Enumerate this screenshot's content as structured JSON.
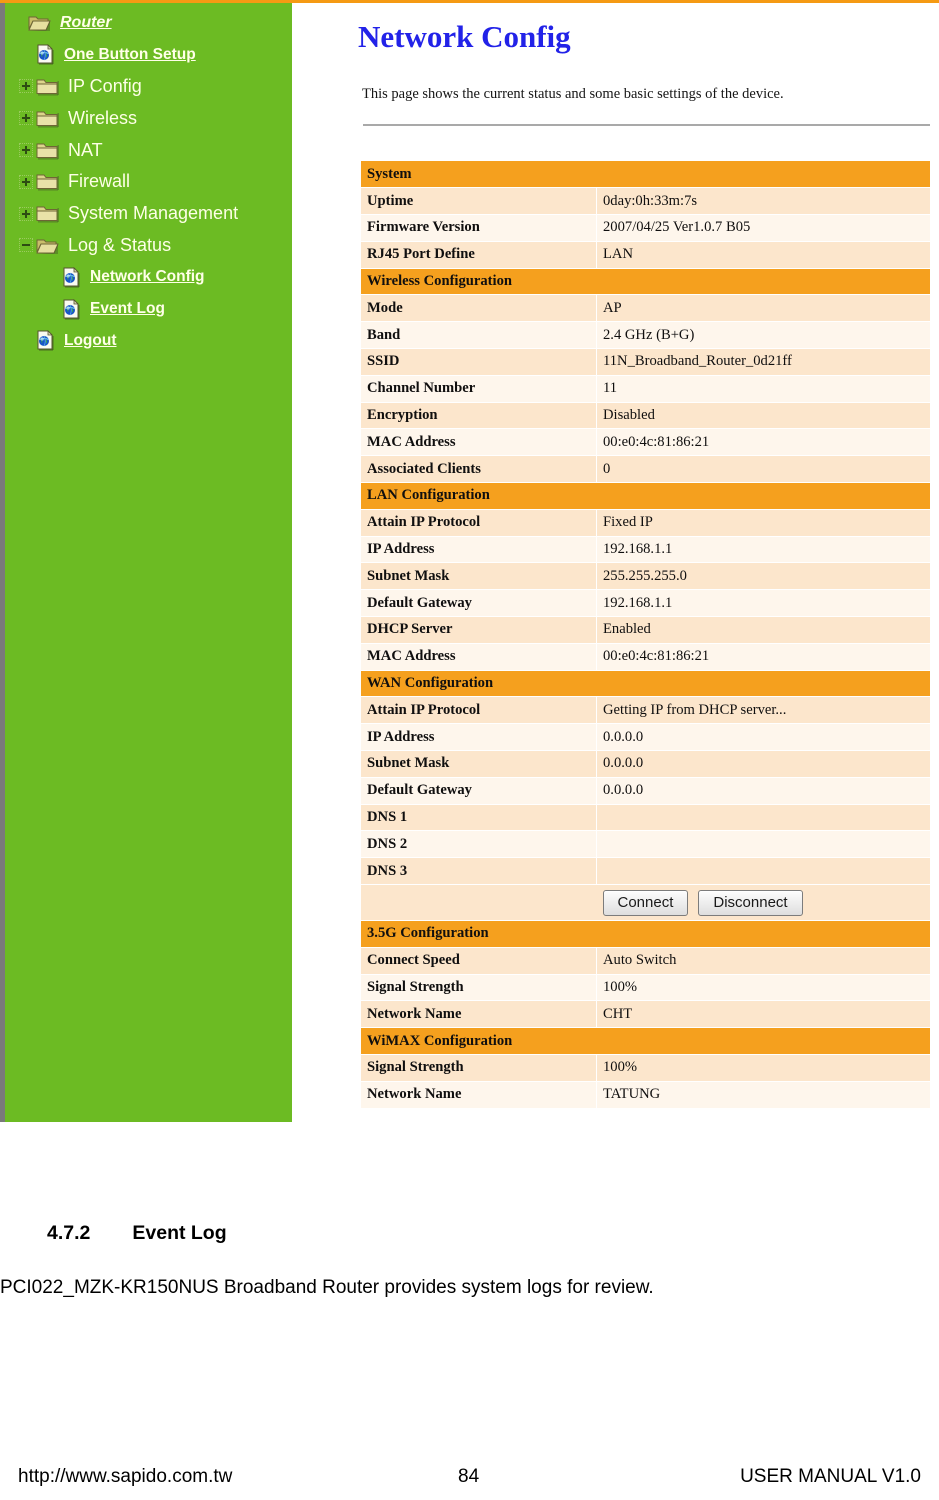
{
  "document": {
    "section_number": "4.7.2",
    "section_title": "Event Log",
    "paragraph": "PCI022_MZK-KR150NUS Broadband Router provides system logs for review.",
    "footer_url": "http://www.sapido.com.tw",
    "footer_page": "84",
    "footer_manual": "USER MANUAL V1.0"
  },
  "colors": {
    "sidebar_green": "#6CBB23",
    "accent_orange": "#F5A01E",
    "title_blue": "#2222E8",
    "row_odd": "#FCE6CC",
    "row_even": "#FEF6EC"
  },
  "sidebar": {
    "items": [
      {
        "label": "Router",
        "icon": "open-folder-icon",
        "level": 0,
        "style": "root",
        "toggle": "none"
      },
      {
        "label": "One Button Setup",
        "icon": "page-globe-icon",
        "level": 1,
        "style": "link",
        "toggle": "none"
      },
      {
        "label": "IP Config",
        "icon": "closed-folder-icon",
        "level": 1,
        "style": "plain",
        "toggle": "plus"
      },
      {
        "label": "Wireless",
        "icon": "closed-folder-icon",
        "level": 1,
        "style": "plain",
        "toggle": "plus"
      },
      {
        "label": "NAT",
        "icon": "closed-folder-icon",
        "level": 1,
        "style": "plain",
        "toggle": "plus"
      },
      {
        "label": "Firewall",
        "icon": "closed-folder-icon",
        "level": 1,
        "style": "plain",
        "toggle": "plus"
      },
      {
        "label": "System Management",
        "icon": "closed-folder-icon",
        "level": 1,
        "style": "plain",
        "toggle": "plus"
      },
      {
        "label": "Log & Status",
        "icon": "open-folder-icon",
        "level": 1,
        "style": "plain",
        "toggle": "minus"
      },
      {
        "label": "Network Config",
        "icon": "page-globe-icon",
        "level": 2,
        "style": "link",
        "toggle": "none"
      },
      {
        "label": "Event Log",
        "icon": "page-globe-icon",
        "level": 2,
        "style": "link",
        "toggle": "none"
      },
      {
        "label": "Logout",
        "icon": "page-globe-icon",
        "level": 1,
        "style": "link",
        "toggle": "none"
      }
    ]
  },
  "main": {
    "title": "Network Config",
    "description": "This page shows the current status and some basic settings of the device.",
    "buttons": {
      "connect": "Connect",
      "disconnect": "Disconnect"
    },
    "sections": [
      {
        "heading": "System",
        "rows": [
          {
            "key": "Uptime",
            "value": "0day:0h:33m:7s"
          },
          {
            "key": "Firmware Version",
            "value": "2007/04/25 Ver1.0.7 B05"
          },
          {
            "key": "RJ45 Port Define",
            "value": "LAN"
          }
        ]
      },
      {
        "heading": "Wireless Configuration",
        "rows": [
          {
            "key": "Mode",
            "value": "AP"
          },
          {
            "key": "Band",
            "value": "2.4 GHz (B+G)"
          },
          {
            "key": "SSID",
            "value": "11N_Broadband_Router_0d21ff"
          },
          {
            "key": "Channel Number",
            "value": "11"
          },
          {
            "key": "Encryption",
            "value": "Disabled"
          },
          {
            "key": "MAC Address",
            "value": "00:e0:4c:81:86:21"
          },
          {
            "key": "Associated Clients",
            "value": "0"
          }
        ]
      },
      {
        "heading": "LAN Configuration",
        "rows": [
          {
            "key": "Attain IP Protocol",
            "value": "Fixed IP"
          },
          {
            "key": "IP Address",
            "value": "192.168.1.1"
          },
          {
            "key": "Subnet Mask",
            "value": "255.255.255.0"
          },
          {
            "key": "Default Gateway",
            "value": "192.168.1.1"
          },
          {
            "key": "DHCP Server",
            "value": "Enabled"
          },
          {
            "key": "MAC Address",
            "value": "00:e0:4c:81:86:21"
          }
        ]
      },
      {
        "heading": "WAN Configuration",
        "rows": [
          {
            "key": "Attain IP Protocol",
            "value": "Getting IP from DHCP server..."
          },
          {
            "key": "IP Address",
            "value": "0.0.0.0"
          },
          {
            "key": "Subnet Mask",
            "value": "0.0.0.0"
          },
          {
            "key": "Default Gateway",
            "value": "0.0.0.0"
          },
          {
            "key": "DNS 1",
            "value": ""
          },
          {
            "key": "DNS 2",
            "value": ""
          },
          {
            "key": "DNS 3",
            "value": ""
          }
        ],
        "has_buttons": true
      },
      {
        "heading": "3.5G Configuration",
        "rows": [
          {
            "key": "Connect Speed",
            "value": "Auto Switch"
          },
          {
            "key": "Signal Strength",
            "value": "100%"
          },
          {
            "key": "Network Name",
            "value": "CHT"
          }
        ]
      },
      {
        "heading": "WiMAX Configuration",
        "rows": [
          {
            "key": "Signal Strength",
            "value": "100%"
          },
          {
            "key": "Network Name",
            "value": "TATUNG"
          }
        ]
      }
    ]
  }
}
